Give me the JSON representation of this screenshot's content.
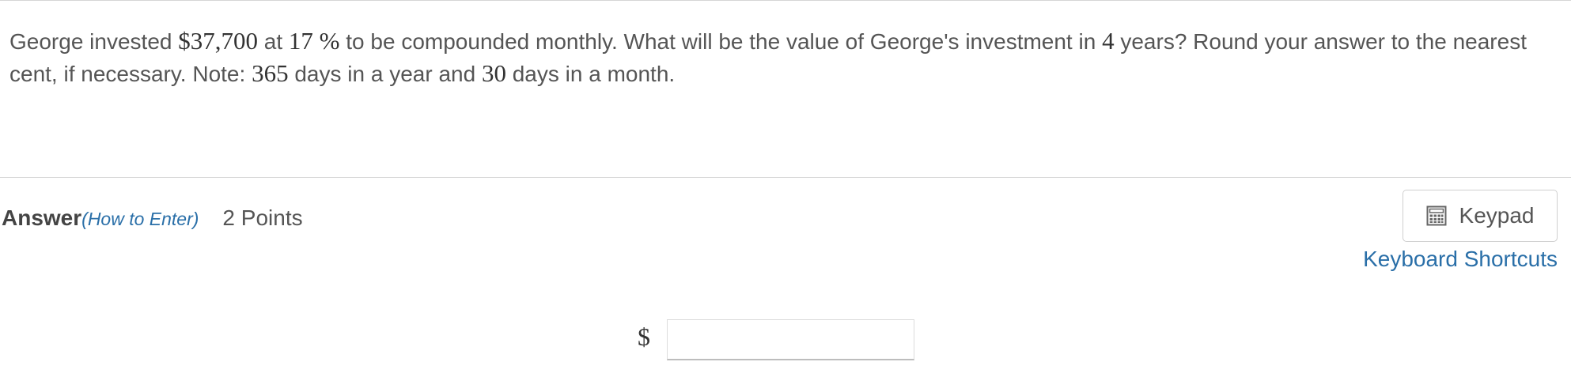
{
  "question": {
    "t1": "George invested ",
    "amount": "$37,700",
    "t2": " at ",
    "rate": "17 %",
    "t3": "  to be compounded monthly. What will be the value of George's investment in ",
    "years": "4",
    "t4": " years? Round your answer to the nearest cent, if necessary. Note: ",
    "days_year": "365",
    "t5": " days in a year and ",
    "days_month": "30",
    "t6": " days in a month."
  },
  "answer": {
    "label": "Answer",
    "how_to": "(How to Enter)",
    "points": "2 Points",
    "currency_symbol": "$",
    "input_value": "",
    "input_placeholder": ""
  },
  "keypad": {
    "label": "Keypad",
    "icon": "calculator-icon"
  },
  "shortcuts": {
    "label": "Keyboard Shortcuts"
  },
  "colors": {
    "text": "#555555",
    "link": "#2a6fa8",
    "rule": "#d6d6d6"
  }
}
